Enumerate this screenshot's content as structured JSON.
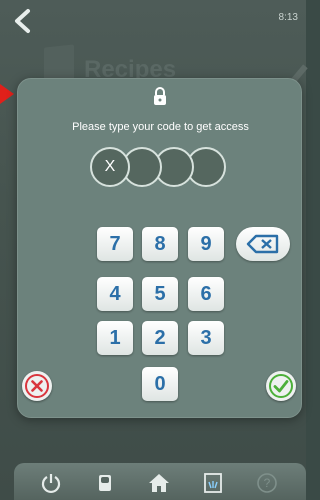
{
  "status": {
    "time": "8:13"
  },
  "background": {
    "title": "Recipes"
  },
  "lock_dialog": {
    "prompt": "Please type your code to get access",
    "code_slots": [
      "X",
      "",
      "",
      ""
    ],
    "keys": {
      "k7": "7",
      "k8": "8",
      "k9": "9",
      "k4": "4",
      "k5": "5",
      "k6": "6",
      "k1": "1",
      "k2": "2",
      "k3": "3",
      "k0": "0"
    }
  },
  "icons": {
    "back": "chevron-left-icon",
    "lock": "lock-icon",
    "backspace": "backspace-icon",
    "cancel": "cancel-icon",
    "confirm": "checkmark-icon",
    "nav": [
      "power-icon",
      "chef-hat-icon",
      "home-icon",
      "dishwasher-icon",
      "help-icon"
    ]
  },
  "colors": {
    "key_text": "#2b6fa8",
    "cancel": "#d9363e",
    "confirm": "#4caf3a",
    "modal_bg": "#6c827c",
    "annotation_arrow": "#e0201a"
  }
}
